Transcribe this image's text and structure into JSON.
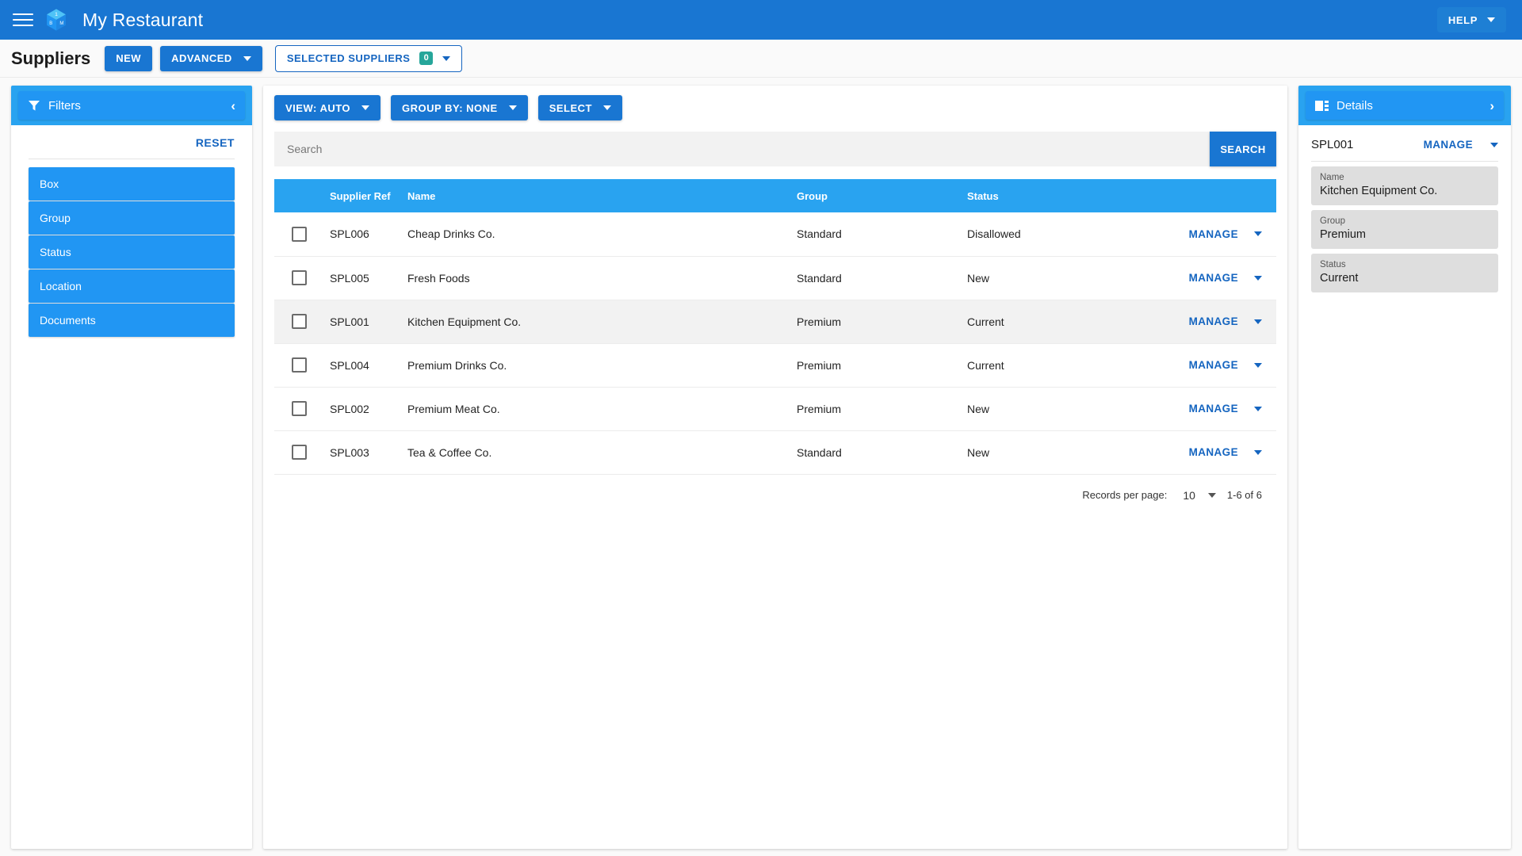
{
  "appbar": {
    "menu_icon": "hamburger-menu-icon",
    "logo_icon": "cube-logo-icon",
    "logo_faces": {
      "top": "1",
      "left": "B",
      "right": "M"
    },
    "title": "My Restaurant",
    "help_label": "HELP"
  },
  "subheader": {
    "page_title": "Suppliers",
    "new_label": "NEW",
    "advanced_label": "ADVANCED",
    "selected_label": "SELECTED SUPPLIERS",
    "selected_count": "0"
  },
  "filters": {
    "header_title": "Filters",
    "collapse_icon": "chevron-left-icon",
    "filter_icon": "funnel-icon",
    "reset_label": "RESET",
    "items": [
      {
        "label": "Box"
      },
      {
        "label": "Group"
      },
      {
        "label": "Status"
      },
      {
        "label": "Location"
      },
      {
        "label": "Documents"
      }
    ]
  },
  "toolbar": {
    "view_label": "VIEW: AUTO",
    "group_by_label": "GROUP BY: NONE",
    "select_label": "SELECT"
  },
  "search": {
    "placeholder": "Search",
    "value": "",
    "button_label": "SEARCH"
  },
  "table": {
    "columns": [
      "Supplier Ref",
      "Name",
      "Group",
      "Status"
    ],
    "action_label": "MANAGE",
    "rows": [
      {
        "ref": "SPL006",
        "name": "Cheap Drinks Co.",
        "group": "Standard",
        "status": "Disallowed",
        "selected": false,
        "checked": false
      },
      {
        "ref": "SPL005",
        "name": "Fresh Foods",
        "group": "Standard",
        "status": "New",
        "selected": false,
        "checked": false
      },
      {
        "ref": "SPL001",
        "name": "Kitchen Equipment Co.",
        "group": "Premium",
        "status": "Current",
        "selected": true,
        "checked": false
      },
      {
        "ref": "SPL004",
        "name": "Premium Drinks Co.",
        "group": "Premium",
        "status": "Current",
        "selected": false,
        "checked": false
      },
      {
        "ref": "SPL002",
        "name": "Premium Meat Co.",
        "group": "Premium",
        "status": "New",
        "selected": false,
        "checked": false
      },
      {
        "ref": "SPL003",
        "name": "Tea & Coffee Co.",
        "group": "Standard",
        "status": "New",
        "selected": false,
        "checked": false
      }
    ]
  },
  "pagination": {
    "records_label": "Records per page:",
    "records_value": "10",
    "range_label": "1-6 of 6"
  },
  "details": {
    "header_title": "Details",
    "panel_icon": "view-detail-icon",
    "expand_icon": "chevron-right-icon",
    "record_ref": "SPL001",
    "manage_label": "MANAGE",
    "fields": [
      {
        "label": "Name",
        "value": "Kitchen Equipment Co."
      },
      {
        "label": "Group",
        "value": "Premium"
      },
      {
        "label": "Status",
        "value": "Current"
      }
    ]
  },
  "colors": {
    "primary": "#1976d2",
    "panel_header": "#2196f3",
    "table_header": "#29a3f0",
    "link": "#1565c0",
    "badge": "#26a69a",
    "row_selected": "#f2f2f2"
  }
}
